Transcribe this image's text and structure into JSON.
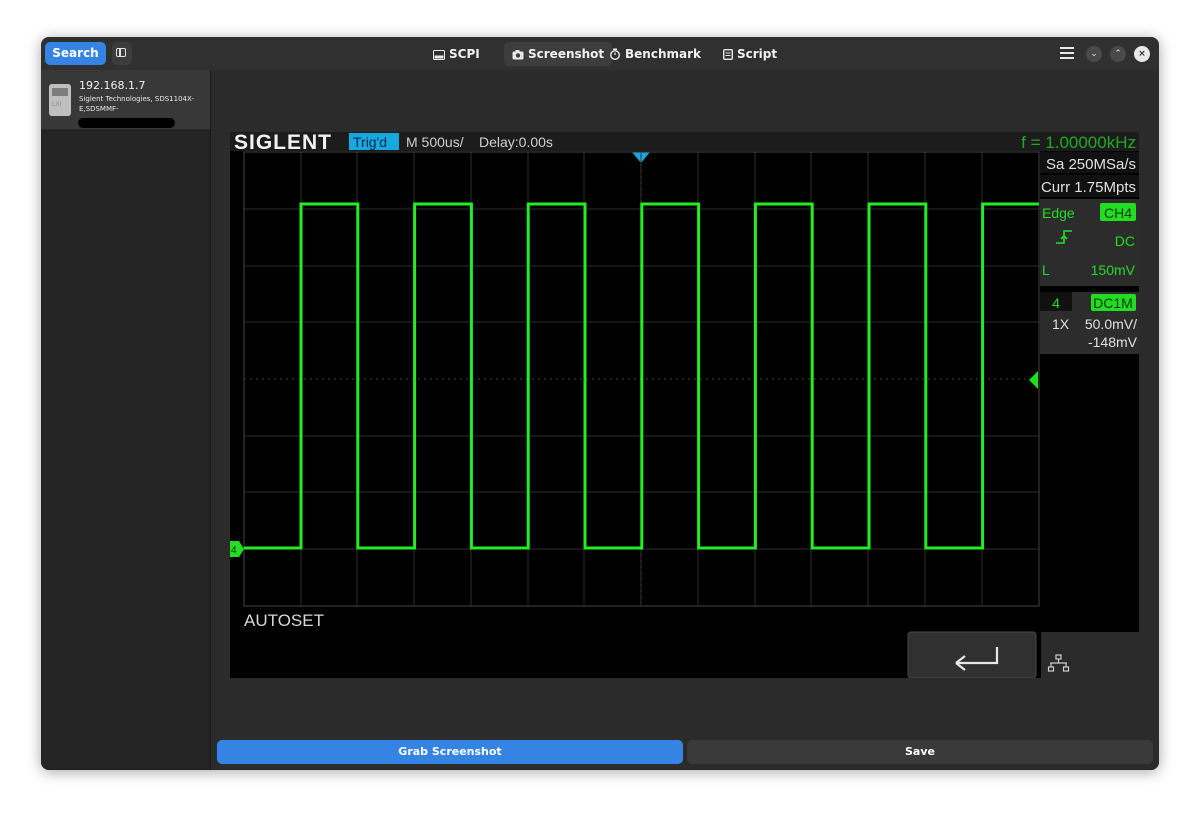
{
  "header": {
    "search_label": "Search",
    "tabs": [
      {
        "label": "SCPI",
        "icon": "terminal-icon"
      },
      {
        "label": "Screenshot",
        "icon": "camera-icon",
        "active": true
      },
      {
        "label": "Benchmark",
        "icon": "stopwatch-icon"
      },
      {
        "label": "Script",
        "icon": "document-icon"
      }
    ]
  },
  "sidebar": {
    "device": {
      "ip": "192.168.1.7",
      "description": "Siglent Technologies, SDS1104X-E,SDSMMF-",
      "icon_text": "LXI"
    }
  },
  "scope": {
    "brand": "SIGLENT",
    "trigger_status": "Trig'd",
    "timebase": "M 500us/",
    "delay": "Delay:0.00s",
    "frequency": "f = 1.00000kHz",
    "sample_rate": "Sa 250MSa/s",
    "memory_depth": "Curr 1.75Mpts",
    "trigger_type": "Edge",
    "trigger_source": "CH4",
    "trigger_coupling": "DC",
    "trigger_level_label": "L",
    "trigger_level": "150mV",
    "channel_number": "4",
    "channel_coupling": "DC1M",
    "probe": "1X",
    "volts_per_div": "50.0mV/",
    "offset": "-148mV",
    "status_message": "AUTOSET",
    "channel_marker": "4",
    "colors": {
      "trace": "#22ee22",
      "accent": "#18a8e0",
      "panel": "#2c2c2c",
      "grid": "#333333"
    }
  },
  "waveform": {
    "type": "square",
    "frequency_hz": 1000,
    "duty": 0.5,
    "channel": "CH4"
  },
  "actions": {
    "grab_label": "Grab Screenshot",
    "save_label": "Save"
  }
}
